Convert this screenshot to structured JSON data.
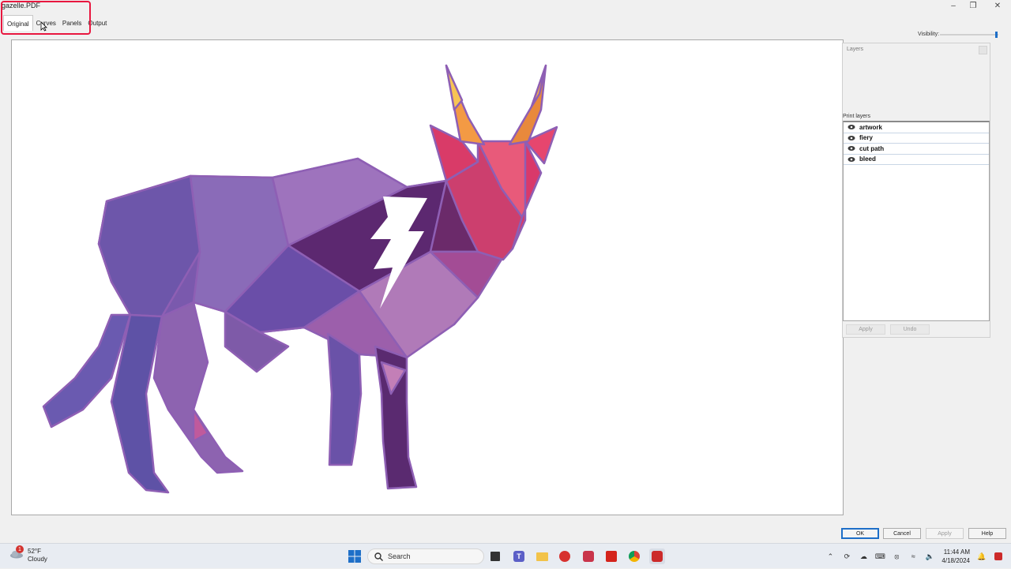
{
  "window": {
    "title": "gazelle.PDF"
  },
  "tabs": [
    {
      "label": "Original"
    },
    {
      "label": "Curves"
    },
    {
      "label": "Panels"
    },
    {
      "label": "Output"
    }
  ],
  "visibility": {
    "label": "Visibility:",
    "value_fraction": 1.0
  },
  "layers_panel": {
    "header": "Layers",
    "print_layers_label": "Print layers",
    "items": [
      {
        "label": "artwork"
      },
      {
        "label": "fiery"
      },
      {
        "label": "cut path"
      },
      {
        "label": "bleed"
      }
    ],
    "apply_label": "Apply",
    "undo_label": "Undo"
  },
  "dialog_buttons": {
    "ok": "OK",
    "cancel": "Cancel",
    "apply": "Apply",
    "help": "Help"
  },
  "taskbar": {
    "weather_temp": "52°F",
    "weather_desc": "Cloudy",
    "weather_badge": "1",
    "search_label": "Search",
    "time": "11:44 AM",
    "date": "4/18/2024"
  },
  "colors": {
    "highlight": "#e8173f",
    "accent": "#1e6fc8",
    "art_outline": "#8e5fb4"
  }
}
